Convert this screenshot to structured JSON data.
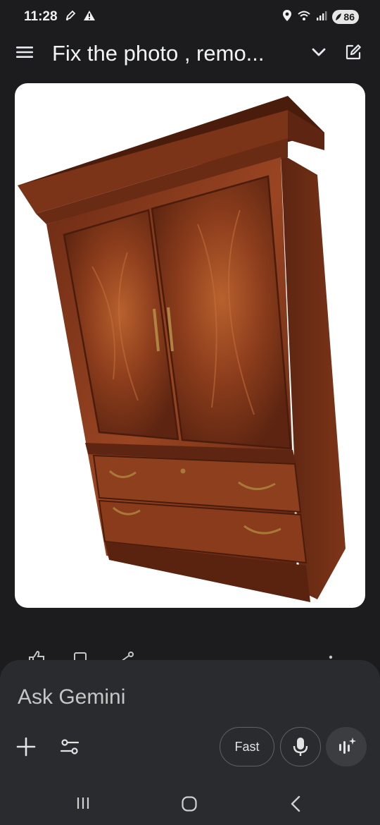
{
  "status_bar": {
    "time": "11:28",
    "battery_level": "86"
  },
  "app_bar": {
    "title": "Fix the photo , remo..."
  },
  "composer": {
    "placeholder": "Ask Gemini",
    "fast_label": "Fast"
  },
  "icons": {
    "menu": "menu-icon",
    "chevron": "chevron-down-icon",
    "edit": "edit-icon",
    "plus": "plus-icon",
    "tools": "tools-icon",
    "mic": "microphone-icon",
    "live": "live-icon"
  },
  "colors": {
    "background": "#1c1c1e",
    "surface": "#2a2b2e",
    "wood_dark": "#5a2312",
    "wood_mid": "#8a3a1c"
  }
}
